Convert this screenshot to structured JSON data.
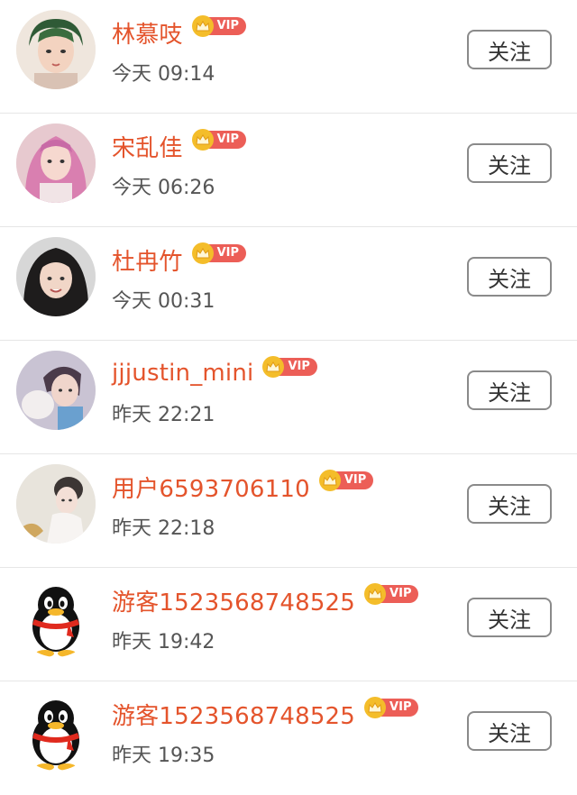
{
  "colors": {
    "name": "#e4542c",
    "vip_crown": "#f4bd2a",
    "vip_tag": "#ec5e57",
    "divider": "#e6e6e6"
  },
  "users": [
    {
      "name": "林慕吱",
      "vip_label": "VIP",
      "time": "今天 09:14",
      "follow_label": "关注",
      "avatar": "photo-avatar"
    },
    {
      "name": "宋乱佳",
      "vip_label": "VIP",
      "time": "今天 06:26",
      "follow_label": "关注",
      "avatar": "photo-avatar"
    },
    {
      "name": "杜冉竹",
      "vip_label": "VIP",
      "time": "今天 00:31",
      "follow_label": "关注",
      "avatar": "photo-avatar"
    },
    {
      "name": "jjjustin_mini",
      "vip_label": "VIP",
      "time": "昨天 22:21",
      "follow_label": "关注",
      "avatar": "photo-avatar"
    },
    {
      "name": "用户6593706110",
      "vip_label": "VIP",
      "time": "昨天 22:18",
      "follow_label": "关注",
      "avatar": "photo-avatar"
    },
    {
      "name": "游客1523568748525",
      "vip_label": "VIP",
      "time": "昨天 19:42",
      "follow_label": "关注",
      "avatar": "qq-penguin-avatar"
    },
    {
      "name": "游客1523568748525",
      "vip_label": "VIP",
      "time": "昨天 19:35",
      "follow_label": "关注",
      "avatar": "qq-penguin-avatar"
    }
  ]
}
